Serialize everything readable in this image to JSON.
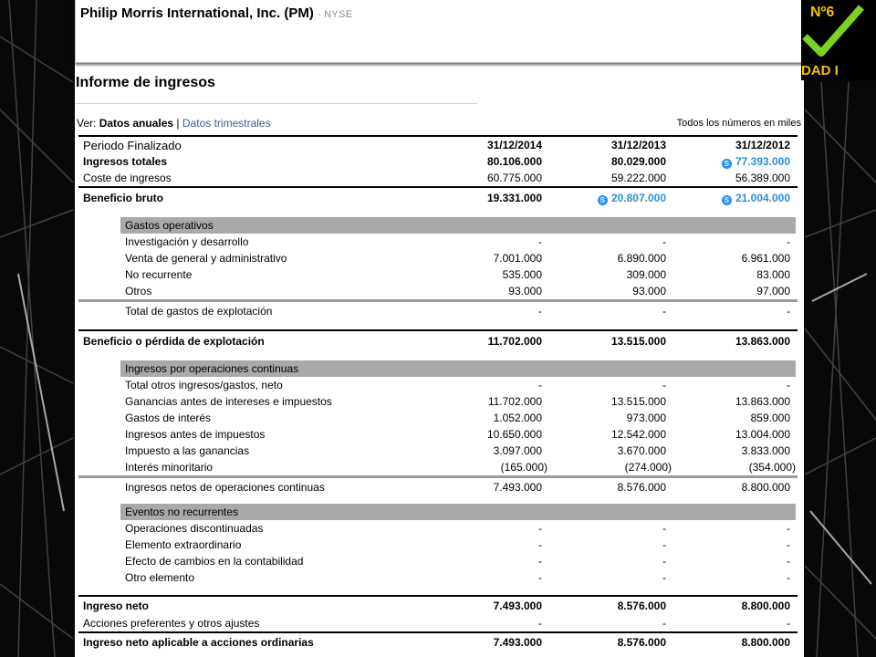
{
  "header": {
    "company": "Philip Morris International, Inc. (PM)",
    "exchange": "- NYSE"
  },
  "report": {
    "title": "Informe de ingresos",
    "view_prefix": "Ver:",
    "view_annual": "Datos anuales",
    "view_separator": "|",
    "view_quarterly": "Datos trimestrales",
    "units_note": "Todos los números en miles"
  },
  "badge": {
    "text_top": "Nº6",
    "text_bottom": "DAD I"
  },
  "columns": [
    "31/12/2014",
    "31/12/2013",
    "31/12/2012"
  ],
  "period_label": "Periodo Finalizado",
  "rows": {
    "ingresos_totales": {
      "label": "Ingresos totales",
      "values": [
        "80.106.000",
        "80.029.000",
        "77.393.000"
      ]
    },
    "coste_ingresos": {
      "label": "Coste de ingresos",
      "values": [
        "60.775.000",
        "59.222.000",
        "56.389.000"
      ]
    },
    "beneficio_bruto": {
      "label": "Beneficio bruto",
      "values": [
        "19.331.000",
        "20.807.000",
        "21.004.000"
      ]
    },
    "gastos_operativos": {
      "label": "Gastos operativos"
    },
    "investigacion": {
      "label": "Investigación y desarrollo",
      "values": [
        "-",
        "-",
        "-"
      ]
    },
    "venta_general": {
      "label": "Venta de general y administrativo",
      "values": [
        "7.001.000",
        "6.890.000",
        "6.961.000"
      ]
    },
    "no_recurrente": {
      "label": "No recurrente",
      "values": [
        "535.000",
        "309.000",
        "83.000"
      ]
    },
    "otros": {
      "label": "Otros",
      "values": [
        "93.000",
        "93.000",
        "97.000"
      ]
    },
    "total_gastos": {
      "label": "Total de gastos de explotación",
      "values": [
        "-",
        "-",
        "-"
      ]
    },
    "beneficio_explotacion": {
      "label": "Beneficio o pérdida de explotación",
      "values": [
        "11.702.000",
        "13.515.000",
        "13.863.000"
      ]
    },
    "ingresos_continuas": {
      "label": "Ingresos por operaciones continuas"
    },
    "total_otros": {
      "label": "Total otros ingresos/gastos, neto",
      "values": [
        "-",
        "-",
        "-"
      ]
    },
    "ganancias_antes": {
      "label": "Ganancias antes de intereses e impuestos",
      "values": [
        "11.702.000",
        "13.515.000",
        "13.863.000"
      ]
    },
    "gastos_interes": {
      "label": "Gastos de interés",
      "values": [
        "1.052.000",
        "973.000",
        "859.000"
      ]
    },
    "ingresos_antes_imp": {
      "label": "Ingresos antes de impuestos",
      "values": [
        "10.650.000",
        "12.542.000",
        "13.004.000"
      ]
    },
    "impuesto": {
      "label": "Impuesto a las ganancias",
      "values": [
        "3.097.000",
        "3.670.000",
        "3.833.000"
      ]
    },
    "interes_minoritario": {
      "label": "Interés minoritario",
      "values": [
        "(165.000)",
        "(274.000)",
        "(354.000)"
      ]
    },
    "ingresos_netos_cont": {
      "label": "Ingresos netos de operaciones continuas",
      "values": [
        "7.493.000",
        "8.576.000",
        "8.800.000"
      ]
    },
    "eventos": {
      "label": "Eventos no recurrentes"
    },
    "op_discontinuadas": {
      "label": "Operaciones discontinuadas",
      "values": [
        "-",
        "-",
        "-"
      ]
    },
    "extraordinario": {
      "label": "Elemento extraordinario",
      "values": [
        "-",
        "-",
        "-"
      ]
    },
    "efecto_cambios": {
      "label": "Efecto de cambios en la contabilidad",
      "values": [
        "-",
        "-",
        "-"
      ]
    },
    "otro_elemento": {
      "label": "Otro elemento",
      "values": [
        "-",
        "-",
        "-"
      ]
    },
    "ingreso_neto": {
      "label": "Ingreso neto",
      "values": [
        "7.493.000",
        "8.576.000",
        "8.800.000"
      ]
    },
    "acciones_pref": {
      "label": "Acciones preferentes y otros ajustes",
      "values": [
        "-",
        "-",
        "-"
      ]
    },
    "ingreso_neto_aplicable": {
      "label": "Ingreso neto aplicable a acciones ordinarias",
      "values": [
        "7.493.000",
        "8.576.000",
        "8.800.000"
      ]
    }
  },
  "skype_icon": "skype-icon",
  "link_color": "#2f8fd3"
}
